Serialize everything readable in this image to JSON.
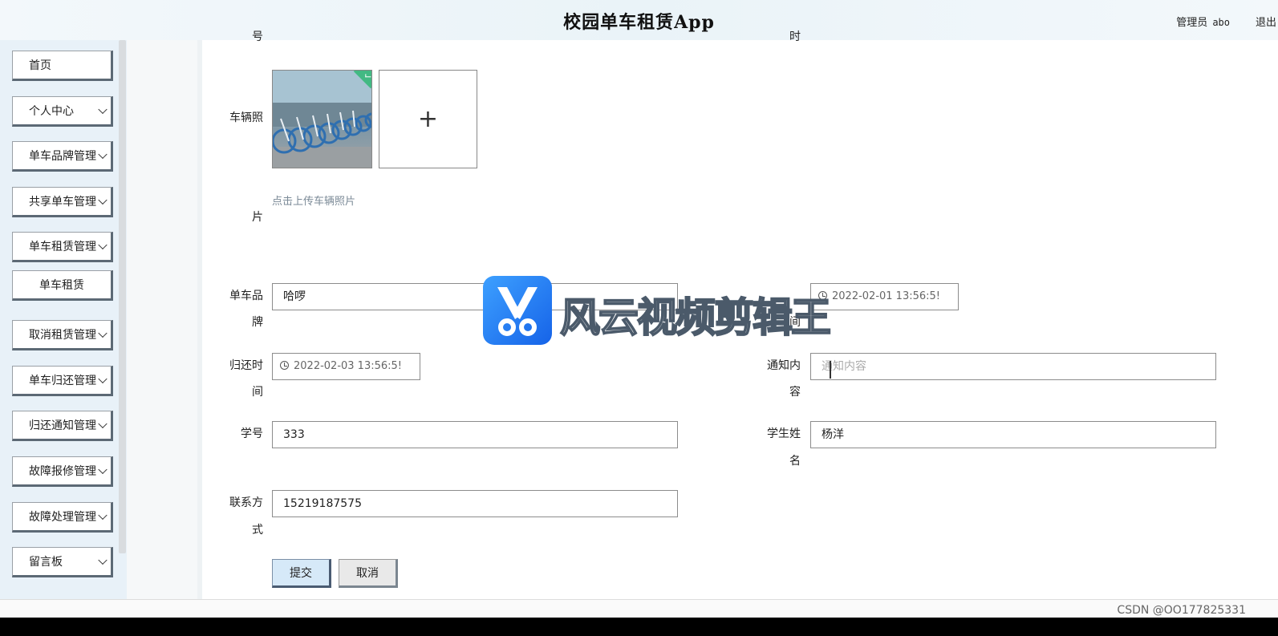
{
  "header": {
    "title": "校园单车租赁App",
    "user_label": "管理员",
    "username": "abo",
    "logout": "退出"
  },
  "sidebar": {
    "items": [
      {
        "label": "首页",
        "has_chevron": false
      },
      {
        "label": "个人中心",
        "has_chevron": true
      },
      {
        "label": "单车品牌管理",
        "has_chevron": true
      },
      {
        "label": "共享单车管理",
        "has_chevron": true
      },
      {
        "label": "单车租赁管理",
        "has_chevron": true
      },
      {
        "label": "单车租赁",
        "has_chevron": false
      },
      {
        "label": "取消租赁管理",
        "has_chevron": true
      },
      {
        "label": "单车归还管理",
        "has_chevron": true
      },
      {
        "label": "归还通知管理",
        "has_chevron": true
      },
      {
        "label": "故障报修管理",
        "has_chevron": true
      },
      {
        "label": "故障处理管理",
        "has_chevron": true
      },
      {
        "label": "留言板",
        "has_chevron": true
      }
    ]
  },
  "form": {
    "partial_label_left": "号",
    "partial_label_right": "时",
    "photo_label_line1": "车辆照",
    "photo_label_line2": "片",
    "upload_plus": "+",
    "upload_hint": "点击上传车辆照片",
    "brand_label_line1": "单车品",
    "brand_label_line2": "牌",
    "brand_value": "哈啰",
    "rent_time_label_tail": "间",
    "rent_time_value": "2022-02-01 13:56:5!",
    "return_time_label_line1": "归还时",
    "return_time_label_line2": "间",
    "return_time_value": "2022-02-03 13:56:5!",
    "notice_label_line1": "通知内",
    "notice_label_line2": "容",
    "notice_placeholder": "通知内容",
    "student_id_label": "学号",
    "student_id_value": "333",
    "student_name_label_line1": "学生姓",
    "student_name_label_line2": "名",
    "student_name_value": "杨洋",
    "contact_label_line1": "联系方",
    "contact_label_line2": "式",
    "contact_value": "15219187575",
    "submit": "提交",
    "cancel": "取消"
  },
  "overlay": {
    "watermark_text": "风云视频剪辑王",
    "csdn_text": "CSDN @OO177825331"
  },
  "colors": {
    "accent_blue": "#1663e8",
    "check_green": "#42b983"
  }
}
